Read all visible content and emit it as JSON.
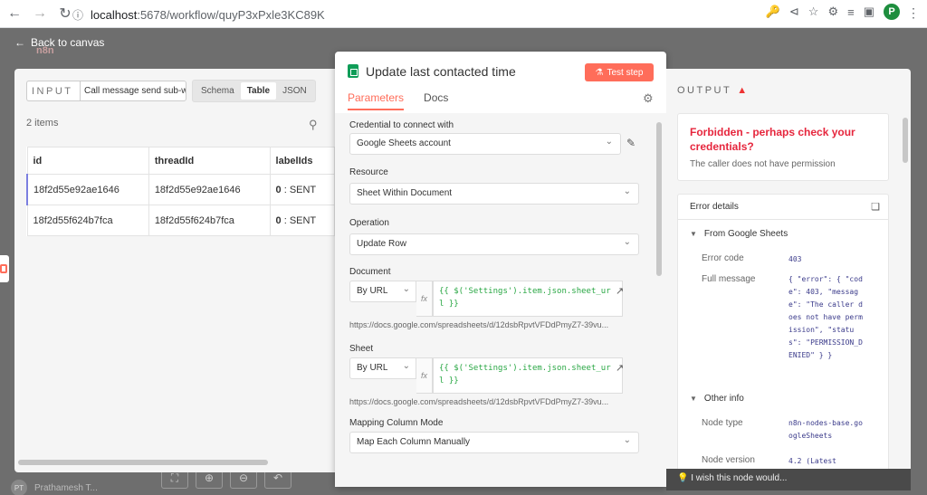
{
  "browser": {
    "url_host": "localhost",
    "url_path": ":5678/workflow/quyP3xPxle3KC89K",
    "profile_initial": "P"
  },
  "app": {
    "back_label": "Back to canvas",
    "logo_text": "n8n",
    "user_initials": "PT",
    "user_name": "Prathamesh T..."
  },
  "input_panel": {
    "label": "INPUT",
    "node_select": "Call message send sub-wo",
    "views": [
      "Schema",
      "Table",
      "JSON"
    ],
    "active_view": "Table",
    "items_count": "2 items",
    "columns": [
      "id",
      "threadId",
      "labelIds"
    ],
    "rows": [
      {
        "id": "18f2d55e92ae1646",
        "threadId": "18f2d55e92ae1646",
        "label_key": "0",
        "label_val": ": SENT"
      },
      {
        "id": "18f2d55f624b7fca",
        "threadId": "18f2d55f624b7fca",
        "label_key": "0",
        "label_val": ": SENT"
      }
    ]
  },
  "node": {
    "title": "Update last contacted time",
    "test_button": "Test step",
    "tabs": [
      "Parameters",
      "Docs"
    ],
    "active_tab": "Parameters",
    "credential_label": "Credential to connect with",
    "credential_value": "Google Sheets account",
    "resource_label": "Resource",
    "resource_value": "Sheet Within Document",
    "operation_label": "Operation",
    "operation_value": "Update Row",
    "document_label": "Document",
    "document_mode": "By URL",
    "document_expr_1": "{{ $('Settings').item.json.sheet_ur",
    "document_expr_2": "l }}",
    "document_url": "https://docs.google.com/spreadsheets/d/12dsbRpvtVFDdPmyZ7-39vu...",
    "sheet_label": "Sheet",
    "sheet_mode": "By URL",
    "sheet_expr_1": "{{ $('Settings').item.json.sheet_ur",
    "sheet_expr_2": "l }}",
    "sheet_url": "https://docs.google.com/spreadsheets/d/12dsbRpvtVFDdPmyZ7-39vu...",
    "mapping_label": "Mapping Column Mode",
    "mapping_value": "Map Each Column Manually"
  },
  "output_panel": {
    "label": "OUTPUT",
    "error_title": "Forbidden - perhaps check your credentials?",
    "error_sub": "The caller does not have permission",
    "details_header": "Error details",
    "section_from": "From Google Sheets",
    "error_code_key": "Error code",
    "error_code_val": "403",
    "full_message_key": "Full message",
    "full_message_val": "{ \"error\": { \"code\": 403, \"message\": \"The caller does not have permission\", \"status\": \"PERMISSION_DENIED\" } }",
    "section_other": "Other info",
    "node_type_key": "Node type",
    "node_type_val": "n8n-nodes-base.googleSheets",
    "node_version_key": "Node version",
    "node_version_val": "4.2 (Latest",
    "tip": "I wish this node would..."
  },
  "colors": {
    "accent": "#ff6d5a",
    "error": "#e6263d",
    "expression": "#29a744",
    "sheets_green": "#0f9d58"
  }
}
